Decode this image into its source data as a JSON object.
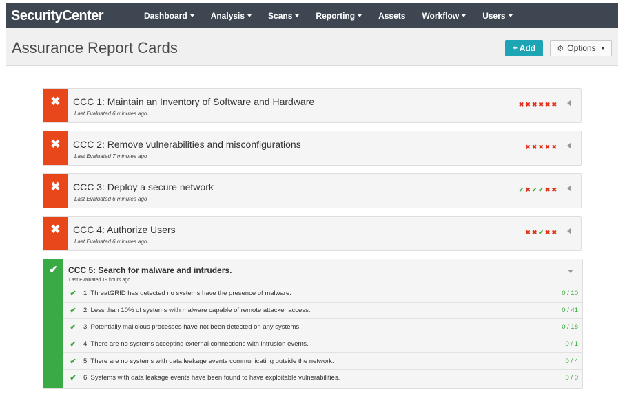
{
  "app": {
    "brand": "SecurityCenter"
  },
  "nav": [
    {
      "label": "Dashboard",
      "dropdown": true
    },
    {
      "label": "Analysis",
      "dropdown": true
    },
    {
      "label": "Scans",
      "dropdown": true
    },
    {
      "label": "Reporting",
      "dropdown": true
    },
    {
      "label": "Assets",
      "dropdown": false
    },
    {
      "label": "Workflow",
      "dropdown": true
    },
    {
      "label": "Users",
      "dropdown": true
    }
  ],
  "header": {
    "title": "Assurance Report Cards",
    "add_label": "+ Add",
    "options_label": "Options"
  },
  "colors": {
    "fail": "#e8461b",
    "pass": "#3aaa45",
    "accent": "#1ea5b5",
    "nav_bg": "#3d4651"
  },
  "cards": [
    {
      "status": "fail",
      "status_icon": "x-icon",
      "title": "CCC 1: Maintain an Inventory of Software and Hardware",
      "subtitle": "Last Evaluated 6 minutes ago",
      "marks": [
        "x",
        "x",
        "x",
        "x",
        "x",
        "x"
      ]
    },
    {
      "status": "fail",
      "status_icon": "x-icon",
      "title": "CCC 2: Remove vulnerabilities and misconfigurations",
      "subtitle": "Last Evaluated 7 minutes ago",
      "marks": [
        "x",
        "x",
        "x",
        "x",
        "x"
      ]
    },
    {
      "status": "fail",
      "status_icon": "x-icon",
      "title": "CCC 3: Deploy a secure network",
      "subtitle": "Last Evaluated 6 minutes ago",
      "marks": [
        "check",
        "x",
        "check",
        "check",
        "x",
        "x"
      ]
    },
    {
      "status": "fail",
      "status_icon": "x-icon",
      "title": "CCC 4: Authorize Users",
      "subtitle": "Last Evaluated 6 minutes ago",
      "marks": [
        "x",
        "x",
        "check",
        "x",
        "x"
      ]
    }
  ],
  "expanded_card": {
    "status": "pass",
    "status_icon": "check-icon",
    "title": "CCC 5: Search for malware and intruders.",
    "subtitle": "Last Evaluated 19 hours ago",
    "rules": [
      {
        "text": "1. ThreatGRID has detected no systems have the presence of malware.",
        "score": "0 / 10"
      },
      {
        "text": "2. Less than 10% of systems with malware capable of remote attacker access.",
        "score": "0 / 41"
      },
      {
        "text": "3. Potentially malicious processes have not been detected on any systems.",
        "score": "0 / 18"
      },
      {
        "text": "4. There are no systems accepting external connections with intrusion events.",
        "score": "0 / 1"
      },
      {
        "text": "5. There are no systems with data leakage events communicating outside the network.",
        "score": "0 / 4"
      },
      {
        "text": "6. Systems with data leakage events have been found to have exploitable vulnerabilities.",
        "score": "0 / 0"
      }
    ]
  }
}
